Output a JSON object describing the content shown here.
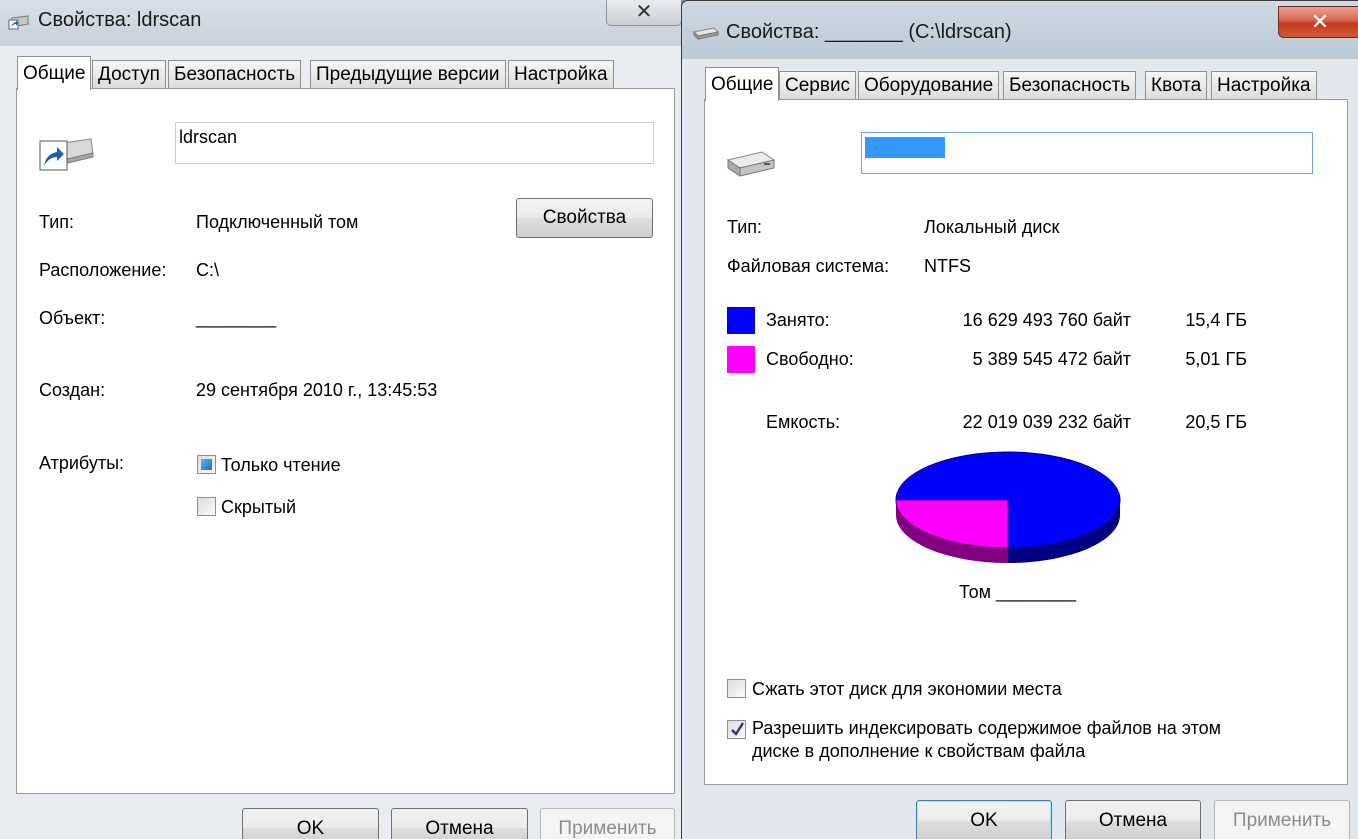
{
  "left_window": {
    "title": "Свойства: ldrscan",
    "close_glyph": "✕",
    "tabs": [
      {
        "label": "Общие",
        "active": true
      },
      {
        "label": "Доступ"
      },
      {
        "label": "Безопасность"
      },
      {
        "label": "Предыдущие версии"
      },
      {
        "label": "Настройка"
      }
    ],
    "name_value": "ldrscan",
    "properties_button": "Свойства",
    "type_label": "Тип:",
    "type_value": "Подключенный том",
    "location_label": "Расположение:",
    "location_value": "C:\\",
    "object_label": "Объект:",
    "object_value": "________",
    "created_label": "Создан:",
    "created_value": "29 сентября 2010 г., 13:45:53",
    "attributes_label": "Атрибуты:",
    "readonly_label": "Только чтение",
    "hidden_label": "Скрытый",
    "readonly_state": "indeterminate",
    "hidden_checked": false,
    "buttons": {
      "ok": "OK",
      "cancel": "Отмена",
      "apply": "Применить"
    }
  },
  "right_window": {
    "title": "Свойства: _______ (C:\\ldrscan)",
    "close_glyph": "✕",
    "tabs": [
      {
        "label": "Общие",
        "active": true
      },
      {
        "label": "Сервис"
      },
      {
        "label": "Оборудование"
      },
      {
        "label": "Безопасность"
      },
      {
        "label": "Квота"
      },
      {
        "label": "Настройка"
      }
    ],
    "type_label": "Тип:",
    "type_value": "Локальный диск",
    "fs_label": "Файловая система:",
    "fs_value": "NTFS",
    "used_label": "Занято:",
    "used_bytes": "16 629 493 760 байт",
    "used_size": "15,4 ГБ",
    "free_label": "Свободно:",
    "free_bytes": "5 389 545 472 байт",
    "free_size": "5,01 ГБ",
    "capacity_label": "Емкость:",
    "capacity_bytes": "22 019 039 232 байт",
    "capacity_size": "20,5 ГБ",
    "volume_label": "Том ________",
    "compress_label": "Сжать этот диск для экономии места",
    "index_label_line1": "Разрешить индексировать содержимое файлов на этом",
    "index_label_line2": "диске в дополнение к свойствам файла",
    "compress_checked": false,
    "index_checked": true,
    "colors": {
      "used": "#0000ff",
      "free": "#ff00ff",
      "used_side": "#000080",
      "free_side": "#800080"
    },
    "buttons": {
      "ok": "OK",
      "cancel": "Отмена",
      "apply": "Применить"
    }
  }
}
